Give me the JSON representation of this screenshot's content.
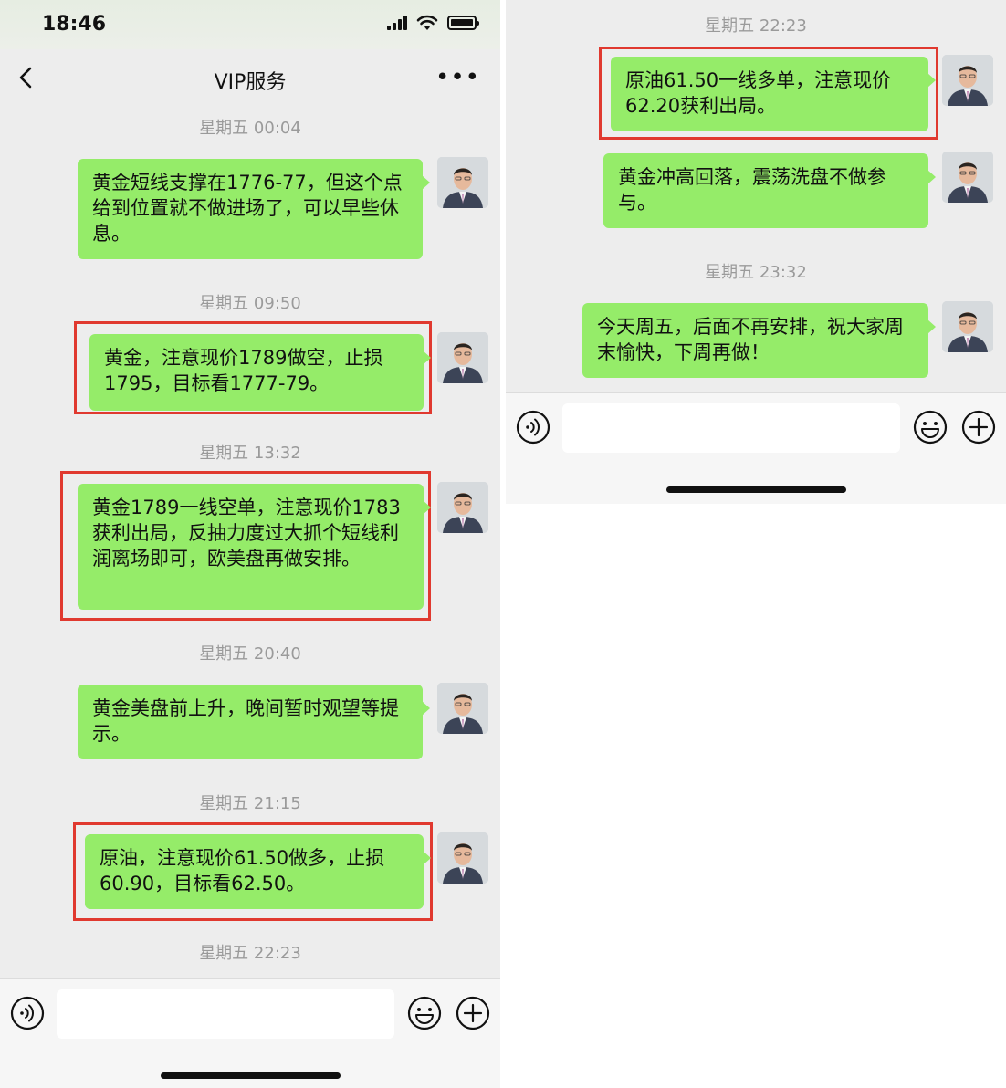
{
  "status_bar": {
    "time": "18:46"
  },
  "nav": {
    "title": "VIP服务"
  },
  "left_messages": [
    {
      "time": "星期五 00:04",
      "text": "黄金短线支撑在1776-77，但这个点给到位置就不做进场了，可以早些休息。"
    },
    {
      "time": "星期五 09:50",
      "text": "黄金，注意现价1789做空，止损1795，目标看1777-79。"
    },
    {
      "time": "星期五 13:32",
      "text": "黄金1789一线空单，注意现价1783获利出局，反抽力度过大抓个短线利润离场即可，欧美盘再做安排。"
    },
    {
      "time": "星期五 20:40",
      "text": "黄金美盘前上升，晚间暂时观望等提示。"
    },
    {
      "time": "星期五 21:15",
      "text": "原油，注意现价61.50做多，止损60.90，目标看62.50。"
    },
    {
      "time": "星期五 22:23"
    }
  ],
  "right_messages": [
    {
      "time": "星期五 22:23",
      "text": "原油61.50一线多单，注意现价62.20获利出局。"
    },
    {
      "text": "黄金冲高回落，震荡洗盘不做参与。"
    },
    {
      "time": "星期五 23:32",
      "text": "今天周五，后面不再安排，祝大家周末愉快，下周再做！"
    }
  ],
  "input": {
    "placeholder": ""
  },
  "colors": {
    "bubble": "#95ec69",
    "background": "#ededed",
    "highlight": "#e0392f"
  },
  "icons": [
    "back-icon",
    "more-icon",
    "voice-icon",
    "emoji-icon",
    "plus-icon",
    "signal-icon",
    "wifi-icon",
    "battery-icon"
  ]
}
